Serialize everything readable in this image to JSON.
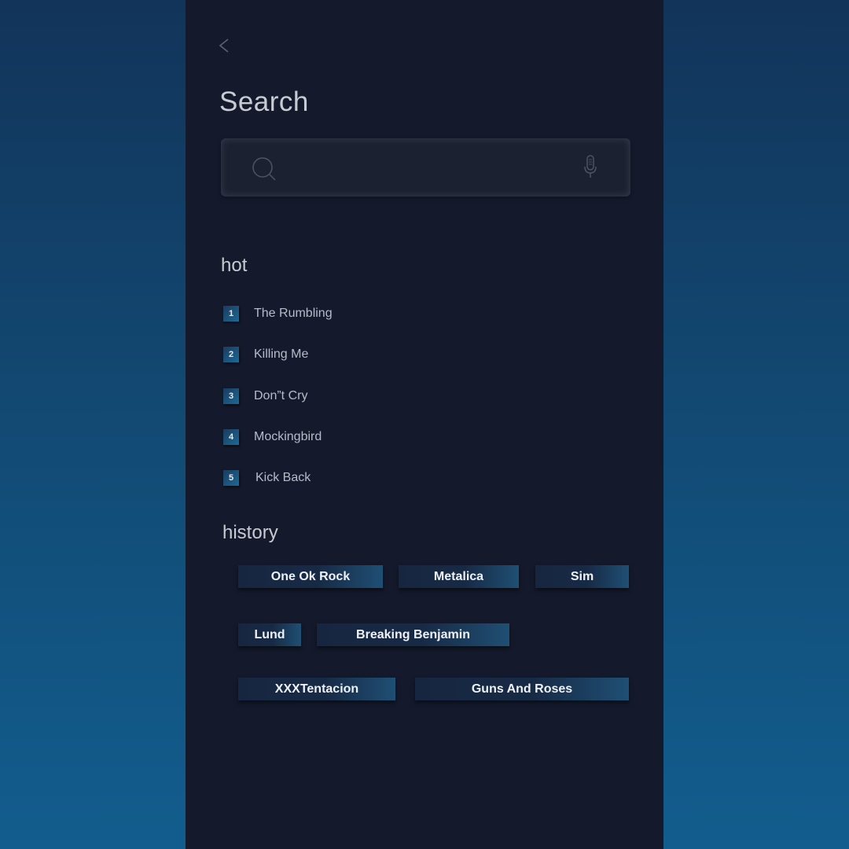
{
  "header": {
    "back_icon": "chevron-left-icon",
    "title": "Search"
  },
  "search": {
    "value": "",
    "placeholder": "",
    "search_icon": "search-icon",
    "mic_icon": "microphone-icon"
  },
  "hot": {
    "title": "hot",
    "items": [
      {
        "rank": "1",
        "label": "The Rumbling"
      },
      {
        "rank": "2",
        "label": "Killing Me"
      },
      {
        "rank": "3",
        "label": "Don”t Cry"
      },
      {
        "rank": "4",
        "label": "Mockingbird"
      },
      {
        "rank": "5",
        "label": "Kick Back"
      }
    ]
  },
  "history": {
    "title": "history",
    "chips": [
      "One Ok Rock",
      "Metalica",
      "Sim",
      "Lund",
      "Breaking Benjamin",
      "XXXTentacion",
      "Guns And Roses"
    ]
  },
  "colors": {
    "background_top": "#12345a",
    "background_bottom": "#125d8e",
    "panel": "#141a2c",
    "search_bar": "#1b2131",
    "accent": "#1a6a98",
    "text": "#c8cbd2"
  }
}
